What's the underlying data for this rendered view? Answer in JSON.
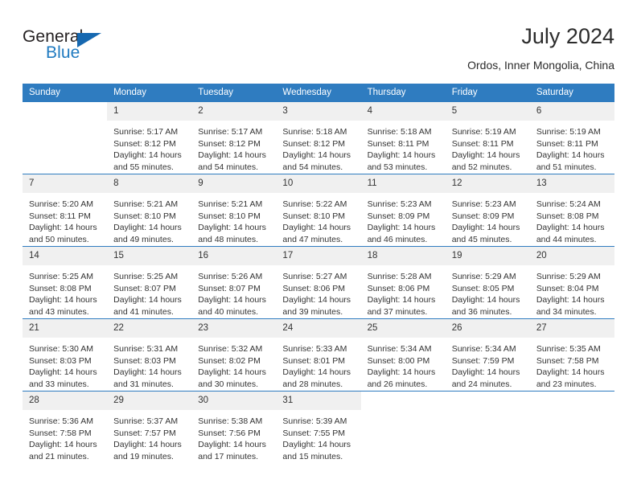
{
  "brand": {
    "name_part1": "General",
    "name_part2": "Blue",
    "logo_icon": "blue-triangle-icon"
  },
  "header": {
    "title": "July 2024",
    "location": "Ordos, Inner Mongolia, China"
  },
  "colors": {
    "header_blue": "#2f7cc0",
    "brand_blue": "#1f7ac0",
    "daynum_band": "#f0f0f0",
    "text": "#333333"
  },
  "weekday_headers": [
    "Sunday",
    "Monday",
    "Tuesday",
    "Wednesday",
    "Thursday",
    "Friday",
    "Saturday"
  ],
  "weeks": [
    [
      {
        "day": "",
        "sunrise": "",
        "sunset": "",
        "daylight_line1": "",
        "daylight_line2": ""
      },
      {
        "day": "1",
        "sunrise": "Sunrise: 5:17 AM",
        "sunset": "Sunset: 8:12 PM",
        "daylight_line1": "Daylight: 14 hours",
        "daylight_line2": "and 55 minutes."
      },
      {
        "day": "2",
        "sunrise": "Sunrise: 5:17 AM",
        "sunset": "Sunset: 8:12 PM",
        "daylight_line1": "Daylight: 14 hours",
        "daylight_line2": "and 54 minutes."
      },
      {
        "day": "3",
        "sunrise": "Sunrise: 5:18 AM",
        "sunset": "Sunset: 8:12 PM",
        "daylight_line1": "Daylight: 14 hours",
        "daylight_line2": "and 54 minutes."
      },
      {
        "day": "4",
        "sunrise": "Sunrise: 5:18 AM",
        "sunset": "Sunset: 8:11 PM",
        "daylight_line1": "Daylight: 14 hours",
        "daylight_line2": "and 53 minutes."
      },
      {
        "day": "5",
        "sunrise": "Sunrise: 5:19 AM",
        "sunset": "Sunset: 8:11 PM",
        "daylight_line1": "Daylight: 14 hours",
        "daylight_line2": "and 52 minutes."
      },
      {
        "day": "6",
        "sunrise": "Sunrise: 5:19 AM",
        "sunset": "Sunset: 8:11 PM",
        "daylight_line1": "Daylight: 14 hours",
        "daylight_line2": "and 51 minutes."
      }
    ],
    [
      {
        "day": "7",
        "sunrise": "Sunrise: 5:20 AM",
        "sunset": "Sunset: 8:11 PM",
        "daylight_line1": "Daylight: 14 hours",
        "daylight_line2": "and 50 minutes."
      },
      {
        "day": "8",
        "sunrise": "Sunrise: 5:21 AM",
        "sunset": "Sunset: 8:10 PM",
        "daylight_line1": "Daylight: 14 hours",
        "daylight_line2": "and 49 minutes."
      },
      {
        "day": "9",
        "sunrise": "Sunrise: 5:21 AM",
        "sunset": "Sunset: 8:10 PM",
        "daylight_line1": "Daylight: 14 hours",
        "daylight_line2": "and 48 minutes."
      },
      {
        "day": "10",
        "sunrise": "Sunrise: 5:22 AM",
        "sunset": "Sunset: 8:10 PM",
        "daylight_line1": "Daylight: 14 hours",
        "daylight_line2": "and 47 minutes."
      },
      {
        "day": "11",
        "sunrise": "Sunrise: 5:23 AM",
        "sunset": "Sunset: 8:09 PM",
        "daylight_line1": "Daylight: 14 hours",
        "daylight_line2": "and 46 minutes."
      },
      {
        "day": "12",
        "sunrise": "Sunrise: 5:23 AM",
        "sunset": "Sunset: 8:09 PM",
        "daylight_line1": "Daylight: 14 hours",
        "daylight_line2": "and 45 minutes."
      },
      {
        "day": "13",
        "sunrise": "Sunrise: 5:24 AM",
        "sunset": "Sunset: 8:08 PM",
        "daylight_line1": "Daylight: 14 hours",
        "daylight_line2": "and 44 minutes."
      }
    ],
    [
      {
        "day": "14",
        "sunrise": "Sunrise: 5:25 AM",
        "sunset": "Sunset: 8:08 PM",
        "daylight_line1": "Daylight: 14 hours",
        "daylight_line2": "and 43 minutes."
      },
      {
        "day": "15",
        "sunrise": "Sunrise: 5:25 AM",
        "sunset": "Sunset: 8:07 PM",
        "daylight_line1": "Daylight: 14 hours",
        "daylight_line2": "and 41 minutes."
      },
      {
        "day": "16",
        "sunrise": "Sunrise: 5:26 AM",
        "sunset": "Sunset: 8:07 PM",
        "daylight_line1": "Daylight: 14 hours",
        "daylight_line2": "and 40 minutes."
      },
      {
        "day": "17",
        "sunrise": "Sunrise: 5:27 AM",
        "sunset": "Sunset: 8:06 PM",
        "daylight_line1": "Daylight: 14 hours",
        "daylight_line2": "and 39 minutes."
      },
      {
        "day": "18",
        "sunrise": "Sunrise: 5:28 AM",
        "sunset": "Sunset: 8:06 PM",
        "daylight_line1": "Daylight: 14 hours",
        "daylight_line2": "and 37 minutes."
      },
      {
        "day": "19",
        "sunrise": "Sunrise: 5:29 AM",
        "sunset": "Sunset: 8:05 PM",
        "daylight_line1": "Daylight: 14 hours",
        "daylight_line2": "and 36 minutes."
      },
      {
        "day": "20",
        "sunrise": "Sunrise: 5:29 AM",
        "sunset": "Sunset: 8:04 PM",
        "daylight_line1": "Daylight: 14 hours",
        "daylight_line2": "and 34 minutes."
      }
    ],
    [
      {
        "day": "21",
        "sunrise": "Sunrise: 5:30 AM",
        "sunset": "Sunset: 8:03 PM",
        "daylight_line1": "Daylight: 14 hours",
        "daylight_line2": "and 33 minutes."
      },
      {
        "day": "22",
        "sunrise": "Sunrise: 5:31 AM",
        "sunset": "Sunset: 8:03 PM",
        "daylight_line1": "Daylight: 14 hours",
        "daylight_line2": "and 31 minutes."
      },
      {
        "day": "23",
        "sunrise": "Sunrise: 5:32 AM",
        "sunset": "Sunset: 8:02 PM",
        "daylight_line1": "Daylight: 14 hours",
        "daylight_line2": "and 30 minutes."
      },
      {
        "day": "24",
        "sunrise": "Sunrise: 5:33 AM",
        "sunset": "Sunset: 8:01 PM",
        "daylight_line1": "Daylight: 14 hours",
        "daylight_line2": "and 28 minutes."
      },
      {
        "day": "25",
        "sunrise": "Sunrise: 5:34 AM",
        "sunset": "Sunset: 8:00 PM",
        "daylight_line1": "Daylight: 14 hours",
        "daylight_line2": "and 26 minutes."
      },
      {
        "day": "26",
        "sunrise": "Sunrise: 5:34 AM",
        "sunset": "Sunset: 7:59 PM",
        "daylight_line1": "Daylight: 14 hours",
        "daylight_line2": "and 24 minutes."
      },
      {
        "day": "27",
        "sunrise": "Sunrise: 5:35 AM",
        "sunset": "Sunset: 7:58 PM",
        "daylight_line1": "Daylight: 14 hours",
        "daylight_line2": "and 23 minutes."
      }
    ],
    [
      {
        "day": "28",
        "sunrise": "Sunrise: 5:36 AM",
        "sunset": "Sunset: 7:58 PM",
        "daylight_line1": "Daylight: 14 hours",
        "daylight_line2": "and 21 minutes."
      },
      {
        "day": "29",
        "sunrise": "Sunrise: 5:37 AM",
        "sunset": "Sunset: 7:57 PM",
        "daylight_line1": "Daylight: 14 hours",
        "daylight_line2": "and 19 minutes."
      },
      {
        "day": "30",
        "sunrise": "Sunrise: 5:38 AM",
        "sunset": "Sunset: 7:56 PM",
        "daylight_line1": "Daylight: 14 hours",
        "daylight_line2": "and 17 minutes."
      },
      {
        "day": "31",
        "sunrise": "Sunrise: 5:39 AM",
        "sunset": "Sunset: 7:55 PM",
        "daylight_line1": "Daylight: 14 hours",
        "daylight_line2": "and 15 minutes."
      },
      {
        "day": "",
        "sunrise": "",
        "sunset": "",
        "daylight_line1": "",
        "daylight_line2": ""
      },
      {
        "day": "",
        "sunrise": "",
        "sunset": "",
        "daylight_line1": "",
        "daylight_line2": ""
      },
      {
        "day": "",
        "sunrise": "",
        "sunset": "",
        "daylight_line1": "",
        "daylight_line2": ""
      }
    ]
  ]
}
